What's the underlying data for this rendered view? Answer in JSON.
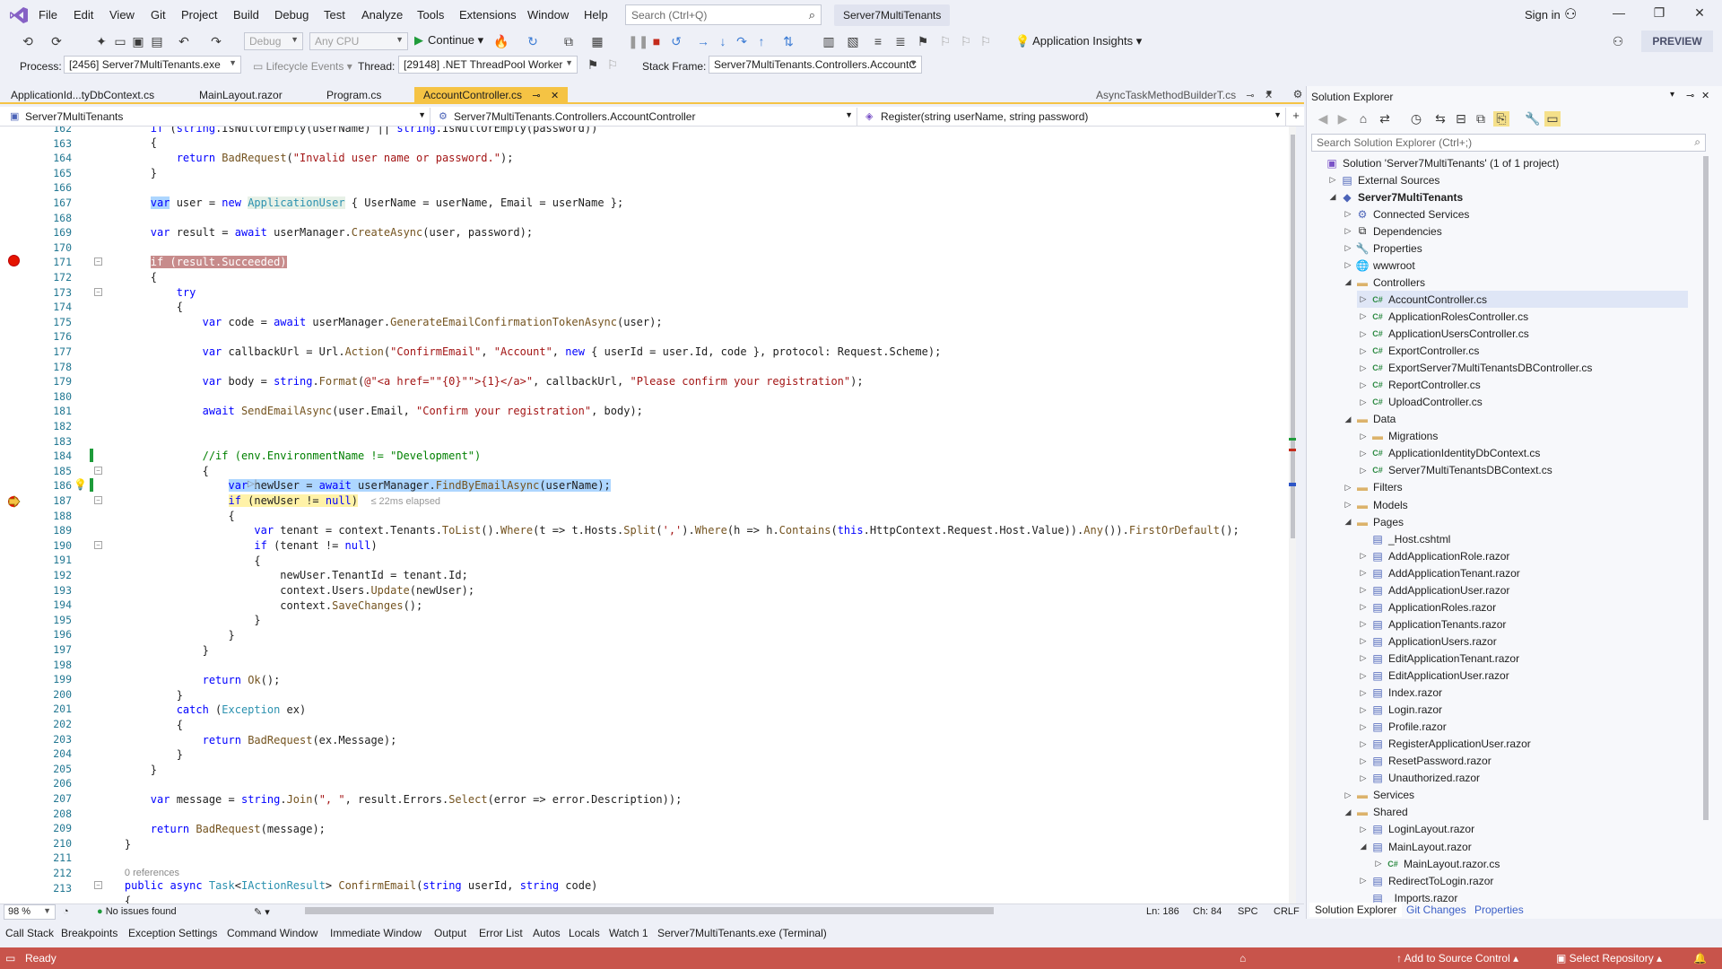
{
  "menubar": {
    "items": [
      "File",
      "Edit",
      "View",
      "Git",
      "Project",
      "Build",
      "Debug",
      "Test",
      "Analyze",
      "Tools",
      "Extensions",
      "Window",
      "Help"
    ],
    "search_placeholder": "Search (Ctrl+Q)",
    "solution_name": "Server7MultiTenants",
    "sign_in": "Sign in",
    "preview": "PREVIEW"
  },
  "toolbar": {
    "config": "Debug",
    "platform": "Any CPU",
    "continue": "Continue",
    "app_insights": "Application Insights"
  },
  "debug_bar": {
    "process_label": "Process:",
    "process_value": "[2456] Server7MultiTenants.exe",
    "lifecycle": "Lifecycle Events",
    "thread_label": "Thread:",
    "thread_value": "[29148] .NET ThreadPool Worker",
    "stack_label": "Stack Frame:",
    "stack_value": "Server7MultiTenants.Controllers.AccountC"
  },
  "doc_tabs": [
    {
      "label": "ApplicationId...tyDbContext.cs"
    },
    {
      "label": "MainLayout.razor"
    },
    {
      "label": "Program.cs"
    },
    {
      "label": "AccountController.cs"
    },
    {
      "label": "AsyncTaskMethodBuilderT.cs"
    }
  ],
  "navbar": {
    "project": "Server7MultiTenants",
    "class": "Server7MultiTenants.Controllers.AccountController",
    "member": "Register(string userName, string password)"
  },
  "editor": {
    "line_numbers": [
      "162",
      "163",
      "164",
      "165",
      "166",
      "167",
      "168",
      "169",
      "170",
      "171",
      "172",
      "173",
      "174",
      "175",
      "176",
      "177",
      "178",
      "179",
      "180",
      "181",
      "182",
      "183",
      "184",
      "185",
      "186",
      "187",
      "188",
      "189",
      "190",
      "191",
      "192",
      "193",
      "194",
      "195",
      "196",
      "197",
      "198",
      "199",
      "200",
      "201",
      "202",
      "203",
      "204",
      "205",
      "206",
      "207",
      "208",
      "209",
      "210",
      "211",
      "212",
      "213"
    ],
    "refs_hint": "0 references",
    "elapsed_hint": "≤ 22ms elapsed"
  },
  "editor_status": {
    "zoom": "98 %",
    "issues": "No issues found",
    "ln": "Ln: 186",
    "ch": "Ch: 84",
    "spc": "SPC",
    "crlf": "CRLF"
  },
  "tool_tabs": [
    "Call Stack",
    "Breakpoints",
    "Exception Settings",
    "Command Window",
    "Immediate Window",
    "Output",
    "Error List",
    "Autos",
    "Locals",
    "Watch 1",
    "Server7MultiTenants.exe (Terminal)"
  ],
  "statusbar": {
    "ready": "Ready",
    "add_source": "Add to Source Control",
    "select_repo": "Select Repository"
  },
  "solution_explorer": {
    "title": "Solution Explorer",
    "search_placeholder": "Search Solution Explorer (Ctrl+;)",
    "items": [
      {
        "label": "Solution 'Server7MultiTenants' (1 of 1 project)",
        "type": "sol",
        "arrow": ""
      },
      {
        "label": "External Sources",
        "type": "ext",
        "arrow": "▷"
      },
      {
        "label": "Server7MultiTenants",
        "type": "proj",
        "arrow": "◢"
      },
      {
        "label": "Connected Services",
        "type": "svc",
        "arrow": "▷"
      },
      {
        "label": "Dependencies",
        "type": "dep",
        "arrow": "▷"
      },
      {
        "label": "Properties",
        "type": "prop",
        "arrow": "▷"
      },
      {
        "label": "wwwroot",
        "type": "web",
        "arrow": "▷"
      },
      {
        "label": "Controllers",
        "type": "folder",
        "arrow": "◢"
      },
      {
        "label": "AccountController.cs",
        "type": "cs",
        "arrow": "▷"
      },
      {
        "label": "ApplicationRolesController.cs",
        "type": "cs",
        "arrow": "▷"
      },
      {
        "label": "ApplicationUsersController.cs",
        "type": "cs",
        "arrow": "▷"
      },
      {
        "label": "ExportController.cs",
        "type": "cs",
        "arrow": "▷"
      },
      {
        "label": "ExportServer7MultiTenantsDBController.cs",
        "type": "cs",
        "arrow": "▷"
      },
      {
        "label": "ReportController.cs",
        "type": "cs",
        "arrow": "▷"
      },
      {
        "label": "UploadController.cs",
        "type": "cs",
        "arrow": "▷"
      },
      {
        "label": "Data",
        "type": "folder",
        "arrow": "◢"
      },
      {
        "label": "Migrations",
        "type": "folder",
        "arrow": "▷"
      },
      {
        "label": "ApplicationIdentityDbContext.cs",
        "type": "cs",
        "arrow": "▷"
      },
      {
        "label": "Server7MultiTenantsDBContext.cs",
        "type": "cs",
        "arrow": "▷"
      },
      {
        "label": "Filters",
        "type": "folder",
        "arrow": "▷"
      },
      {
        "label": "Models",
        "type": "folder",
        "arrow": "▷"
      },
      {
        "label": "Pages",
        "type": "folder",
        "arrow": "◢"
      },
      {
        "label": "_Host.cshtml",
        "type": "razor",
        "arrow": ""
      },
      {
        "label": "AddApplicationRole.razor",
        "type": "razor",
        "arrow": "▷"
      },
      {
        "label": "AddApplicationTenant.razor",
        "type": "razor",
        "arrow": "▷"
      },
      {
        "label": "AddApplicationUser.razor",
        "type": "razor",
        "arrow": "▷"
      },
      {
        "label": "ApplicationRoles.razor",
        "type": "razor",
        "arrow": "▷"
      },
      {
        "label": "ApplicationTenants.razor",
        "type": "razor",
        "arrow": "▷"
      },
      {
        "label": "ApplicationUsers.razor",
        "type": "razor",
        "arrow": "▷"
      },
      {
        "label": "EditApplicationTenant.razor",
        "type": "razor",
        "arrow": "▷"
      },
      {
        "label": "EditApplicationUser.razor",
        "type": "razor",
        "arrow": "▷"
      },
      {
        "label": "Index.razor",
        "type": "razor",
        "arrow": "▷"
      },
      {
        "label": "Login.razor",
        "type": "razor",
        "arrow": "▷"
      },
      {
        "label": "Profile.razor",
        "type": "razor",
        "arrow": "▷"
      },
      {
        "label": "RegisterApplicationUser.razor",
        "type": "razor",
        "arrow": "▷"
      },
      {
        "label": "ResetPassword.razor",
        "type": "razor",
        "arrow": "▷"
      },
      {
        "label": "Unauthorized.razor",
        "type": "razor",
        "arrow": "▷"
      },
      {
        "label": "Services",
        "type": "folder",
        "arrow": "▷"
      },
      {
        "label": "Shared",
        "type": "folder",
        "arrow": "◢"
      },
      {
        "label": "LoginLayout.razor",
        "type": "razor",
        "arrow": "▷"
      },
      {
        "label": "MainLayout.razor",
        "type": "razor",
        "arrow": "◢"
      },
      {
        "label": "MainLayout.razor.cs",
        "type": "cs",
        "arrow": "▷"
      },
      {
        "label": "RedirectToLogin.razor",
        "type": "razor",
        "arrow": "▷"
      },
      {
        "label": "_Imports.razor",
        "type": "razor",
        "arrow": ""
      }
    ],
    "tabs": [
      "Solution Explorer",
      "Git Changes",
      "Properties"
    ]
  }
}
